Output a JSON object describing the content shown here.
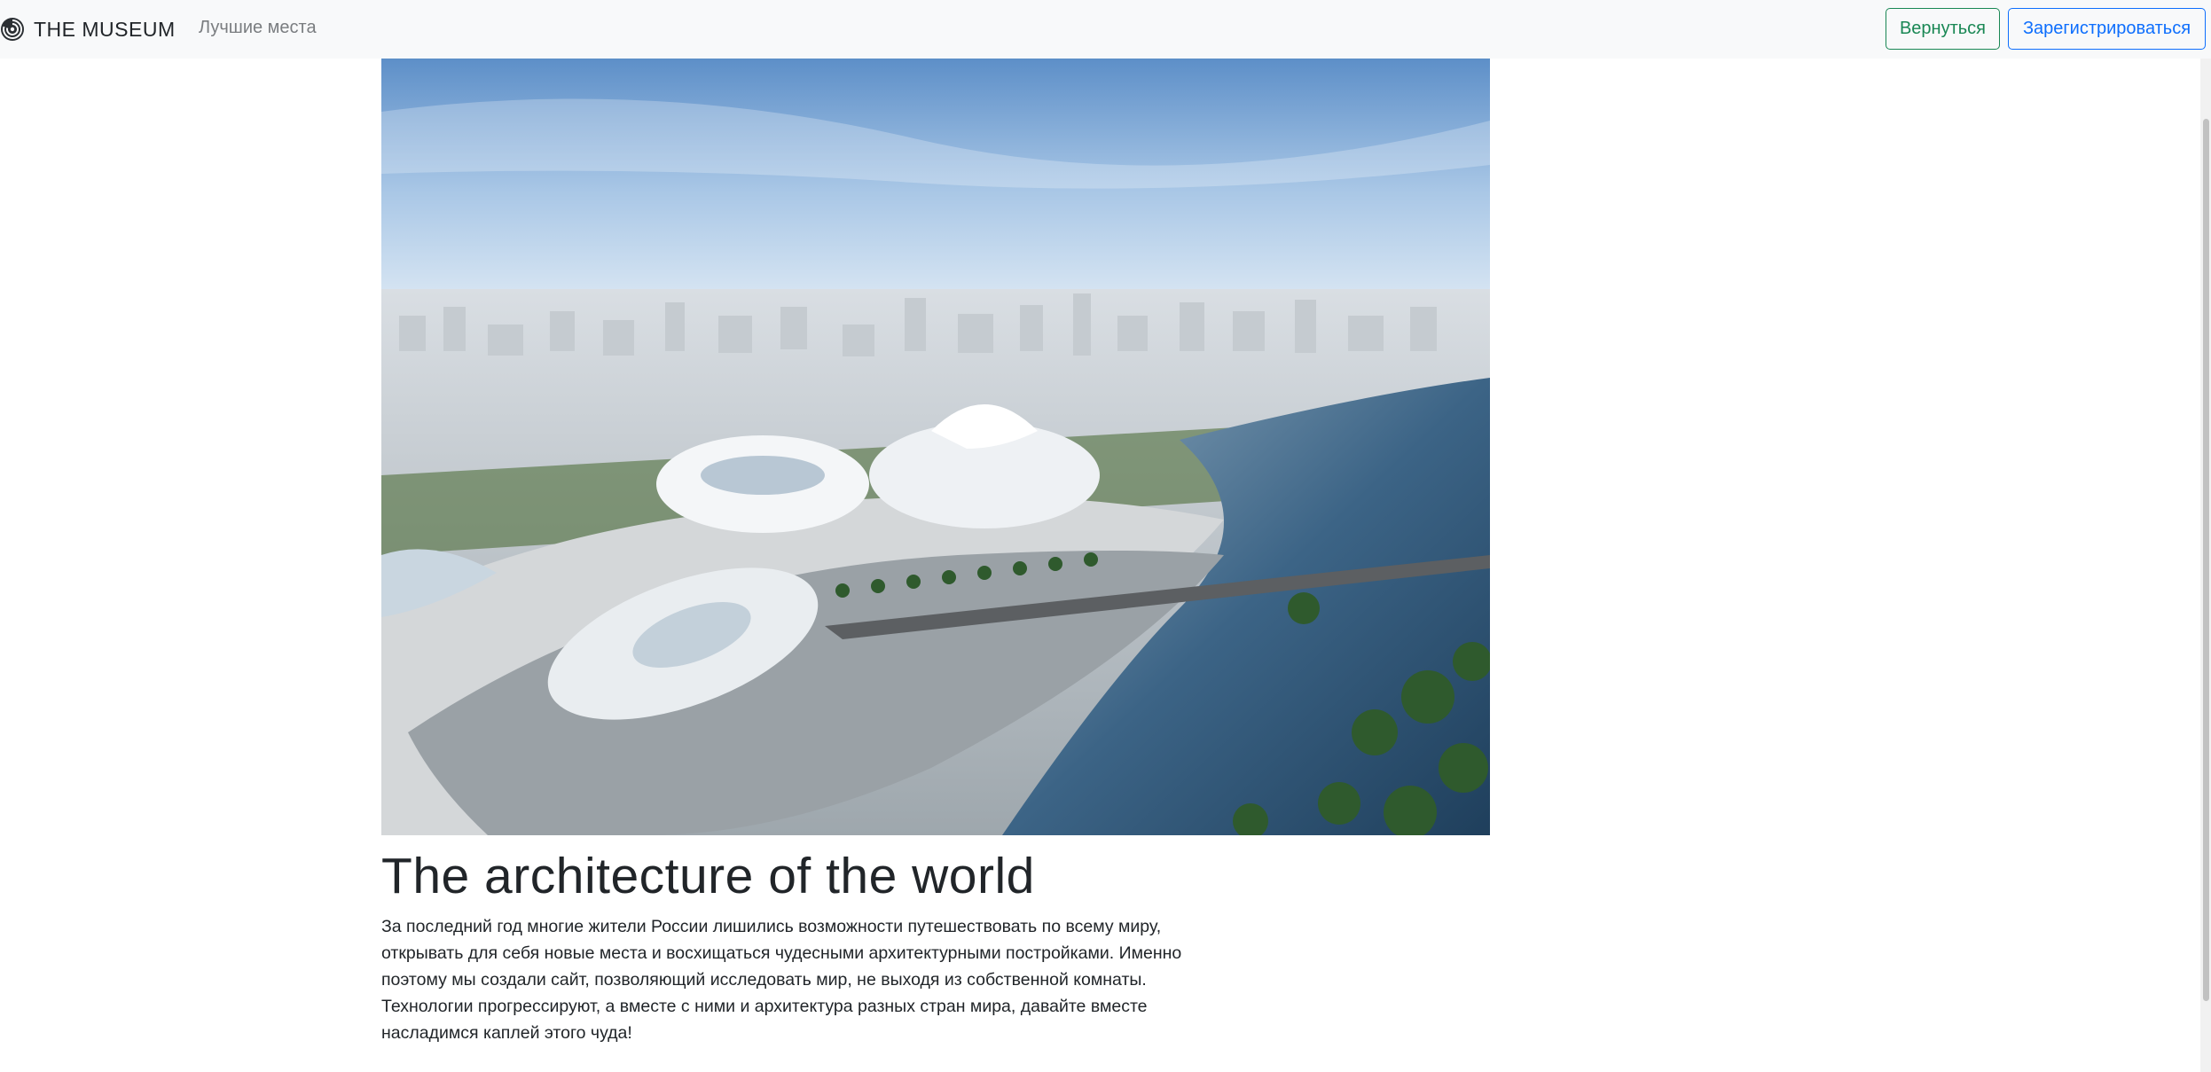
{
  "navbar": {
    "brand": "THE MUSEUM",
    "brand_icon": "museum-logo-icon",
    "link": "Лучшие места",
    "back_button": "Вернуться",
    "register_button": "Зарегистрироваться"
  },
  "hero": {
    "image": "futuristic-architecture-aerial-view"
  },
  "article": {
    "title": "The architecture of the world",
    "description": "За последний год многие жители России лишились возможности путешествовать по всему миру, открывать для себя новые места и восхищаться чудесными архитектурными постройками. Именно поэтому мы создали сайт, позволяющий исследовать мир, не выходя из собственной комнаты. Технологии прогрессируют, а вместе с ними и архитектура разных стран мира, давайте вместе насладимся каплей этого чуда!"
  },
  "colors": {
    "navbar_bg": "#f8f9fa",
    "success": "#198754",
    "primary": "#0d6efd",
    "text": "#212529",
    "muted": "#7a7d80"
  }
}
